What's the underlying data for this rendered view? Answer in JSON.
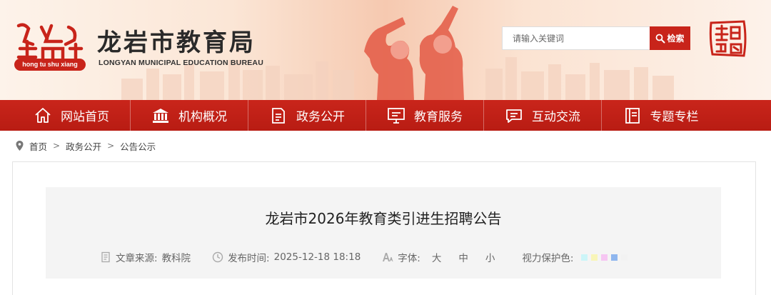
{
  "header": {
    "site_title": "龙岩市教育局",
    "site_subtitle": "LONGYAN MUNICIPAL EDUCATION BUREAU",
    "logo_pill_text": "hong tu shu xiang",
    "search": {
      "placeholder": "请输入关键词",
      "button_label": "检索"
    }
  },
  "nav": {
    "items": [
      {
        "label": "网站首页",
        "icon": "home-icon"
      },
      {
        "label": "机构概况",
        "icon": "institution-icon"
      },
      {
        "label": "政务公开",
        "icon": "document-icon"
      },
      {
        "label": "教育服务",
        "icon": "monitor-icon"
      },
      {
        "label": "互动交流",
        "icon": "chat-icon"
      },
      {
        "label": "专题专栏",
        "icon": "book-icon"
      }
    ]
  },
  "breadcrumb": {
    "items": [
      "首页",
      "政务公开",
      "公告公示"
    ],
    "separator": ">"
  },
  "article": {
    "title": "龙岩市2026年教育类引进生招聘公告",
    "source_label": "文章来源:",
    "source_value": "教科院",
    "date_label": "发布时间:",
    "date_value": "2025-12-18 18:18",
    "font_label": "字体:",
    "font_sizes": [
      "大",
      "中",
      "小"
    ],
    "eye_care_label": "视力保护色:",
    "eye_care_colors": [
      "#ccf5f8",
      "#f8f5b8",
      "#f6c6f2",
      "#8fb6ee",
      "#f2f2f2"
    ]
  },
  "colors": {
    "brand_red": "#c8241a"
  }
}
